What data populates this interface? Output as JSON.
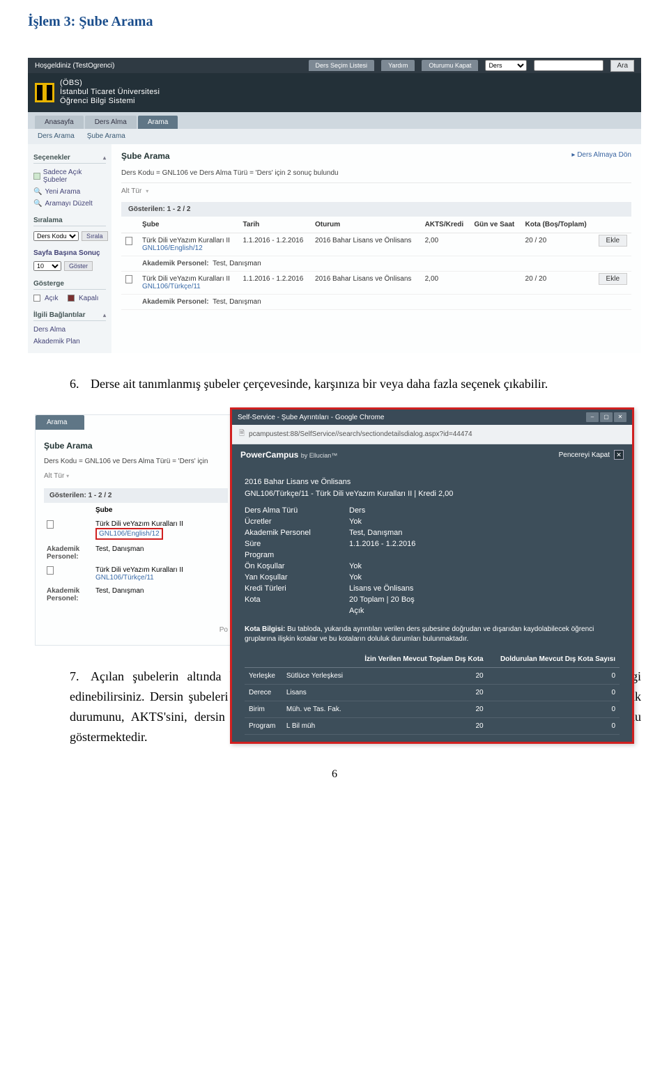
{
  "step_title": "İşlem 3: Şube Arama",
  "paragraph6_num": "6.",
  "paragraph6": "Derse ait tanımlanmış şubeler çerçevesinde, karşınıza bir veya daha fazla seçenek çıkabilir.",
  "paragraph7_num": "7.",
  "paragraph7": "Açılan şubelerin altında bulunan bağlantıyı tıkladığınızda, tıkladığınız şube hakkında ayrıntılı bilgi edinebilirsiniz. Dersin şubeleri o dersin fiziksel olarak yapılacaksa nerede yapılacağını, kontenjanını, doluluk durumunu, AKTS'sini, dersin hangi eğitmen tarafından verildiğini, hangi zaman ve bölümlerde olduğunu göstermektedir.",
  "page_number": "6",
  "obs": {
    "welcome": "Hoşgeldiniz (TestOgrenci)",
    "top_tabs": [
      "Ders Seçim Listesi",
      "Yardım",
      "Oturumu Kapat"
    ],
    "search_select": "Ders",
    "search_btn": "Ara",
    "brand1": "(ÖBS)",
    "brand2": "İstanbul Ticaret Üniversitesi",
    "brand3": "Öğrenci Bilgi Sistemi",
    "nav": [
      "Anasayfa",
      "Ders Alma",
      "Arama"
    ],
    "nav_active": 2,
    "subnav": [
      "Ders Arama",
      "Şube Arama"
    ],
    "side": {
      "secenekler": "Seçenekler",
      "only_open": "Sadece Açık Şubeler",
      "yeni_arama": "Yeni Arama",
      "aramayi_duzelt": "Aramayı Düzelt",
      "siralama": "Sıralama",
      "sort_select": "Ders Kodu",
      "sort_btn": "Sırala",
      "per_page_label": "Sayfa Başına Sonuç",
      "per_page": "10",
      "per_page_btn": "Göster",
      "gosterge": "Gösterge",
      "acik": "Açık",
      "kapali": "Kapalı",
      "ilgili": "İlgili Bağlantılar",
      "ders_alma": "Ders Alma",
      "akademik_plan": "Akademik Plan"
    },
    "main": {
      "title": "Şube Arama",
      "backlink": "▸ Ders Almaya Dön",
      "criteria": "Ders Kodu = GNL106 ve Ders Alma Türü = 'Ders' için 2 sonuç bulundu",
      "alttur": "Alt Tür",
      "count": "Gösterilen: 1 - 2 / 2",
      "cols": [
        "",
        "Şube",
        "Tarih",
        "Oturum",
        "AKTS/Kredi",
        "Gün ve Saat",
        "Kota (Boş/Toplam)",
        ""
      ],
      "rows": [
        {
          "name": "Türk Dili veYazım Kuralları II",
          "link": "GNL106/English/12",
          "tarih": "1.1.2016 - 1.2.2016",
          "oturum": "2016 Bahar Lisans ve Önlisans",
          "akts": "2,00",
          "gun": "",
          "kota": "20 / 20",
          "btn": "Ekle",
          "personel_label": "Akademik Personel:",
          "personel": "Test, Danışman"
        },
        {
          "name": "Türk Dili veYazım Kuralları II",
          "link": "GNL106/Türkçe/11",
          "tarih": "1.1.2016 - 1.2.2016",
          "oturum": "2016 Bahar Lisans ve Önlisans",
          "akts": "2,00",
          "gun": "",
          "kota": "20 / 20",
          "btn": "Ekle",
          "personel_label": "Akademik Personel:",
          "personel": "Test, Danışman"
        }
      ]
    }
  },
  "bg": {
    "tab": "Arama",
    "title": "Şube Arama",
    "criteria": "Ders Kodu = GNL106 ve Ders Alma Türü = 'Ders' için",
    "alttur": "Alt Tür",
    "count": "Gösterilen: 1 - 2 / 2",
    "col_sube": "Şube",
    "rows": [
      {
        "name": "Türk Dili veYazım Kuralları II",
        "link": "GNL106/English/12",
        "highlight": true,
        "personel_label": "Akademik Personel:",
        "personel": "Test, Danışman"
      },
      {
        "name": "Türk Dili veYazım Kuralları II",
        "link": "GNL106/Türkçe/11",
        "highlight": false,
        "personel_label": "Akademik Personel:",
        "personel": "Test, Danışman"
      }
    ],
    "footer": "Po"
  },
  "popup": {
    "chrome_title": "Self-Service - Şube Ayrıntıları - Google Chrome",
    "url": "pcampustest:88/SelfService//search/sectiondetailsdialog.aspx?id=44474",
    "pc_brand": "PowerCampus",
    "pc_by": "by Ellucian™",
    "close_label": "Pencereyi Kapat",
    "course_line1": "2016 Bahar Lisans ve Önlisans",
    "course_line2": "GNL106/Türkçe/11 - Türk Dili veYazım Kuralları II | Kredi 2,00",
    "kv": [
      [
        "Ders Alma Türü",
        "Ders"
      ],
      [
        "Ücretler",
        "Yok"
      ],
      [
        "Akademik Personel",
        "Test, Danışman"
      ],
      [
        "Süre",
        "1.1.2016 - 1.2.2016"
      ],
      [
        "Program",
        ""
      ],
      [
        "Ön Koşullar",
        "Yok"
      ],
      [
        "Yan Koşullar",
        "Yok"
      ],
      [
        "Kredi Türleri",
        "Lisans ve Önlisans"
      ],
      [
        "Kota",
        "20 Toplam | 20 Boş"
      ],
      [
        "",
        "Açık"
      ]
    ],
    "kota_label": "Kota Bilgisi:",
    "kota_text": " Bu tabloda, yukarıda ayrıntıları verilen ders şubesine doğrudan ve dışarıdan kaydolabilecek öğrenci gruplarına ilişkin kotalar ve bu kotaların doluluk durumları bulunmaktadır.",
    "quota_cols": [
      "",
      "",
      "İzin Verilen Mevcut Toplam Dış Kota",
      "Doldurulan Mevcut Dış Kota Sayısı"
    ],
    "quota_rows": [
      [
        "Yerleşke",
        "Sütlüce Yerleşkesi",
        "20",
        "0"
      ],
      [
        "Derece",
        "Lisans",
        "20",
        "0"
      ],
      [
        "Birim",
        "Müh. ve Tas. Fak.",
        "20",
        "0"
      ],
      [
        "Program",
        "L Bil müh",
        "20",
        "0"
      ]
    ]
  }
}
